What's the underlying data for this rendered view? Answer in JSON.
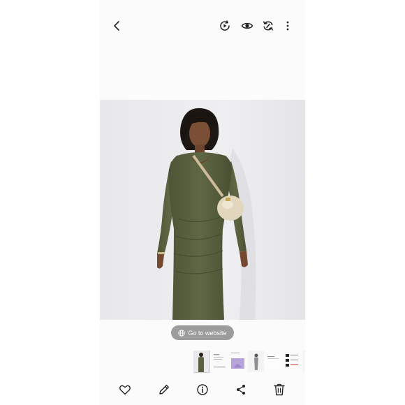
{
  "viewer": {
    "go_to_website_label": "Go to website",
    "icons": {
      "back": "chevron-left-icon",
      "remaster": "remaster-play-icon",
      "view": "eye-icon",
      "rotate": "rotate-icon",
      "more": "more-vertical-icon",
      "globe": "globe-icon",
      "favorite": "heart-icon",
      "edit": "pencil-icon",
      "details": "info-icon",
      "share": "share-icon",
      "delete": "trash-icon"
    },
    "thumbnail_count": 7,
    "colors": {
      "background": "#fbfbfb",
      "photo_background": "#ecebee",
      "dress": "#5a6140",
      "pill": "#9c9c9c",
      "icon": "#222222"
    }
  }
}
